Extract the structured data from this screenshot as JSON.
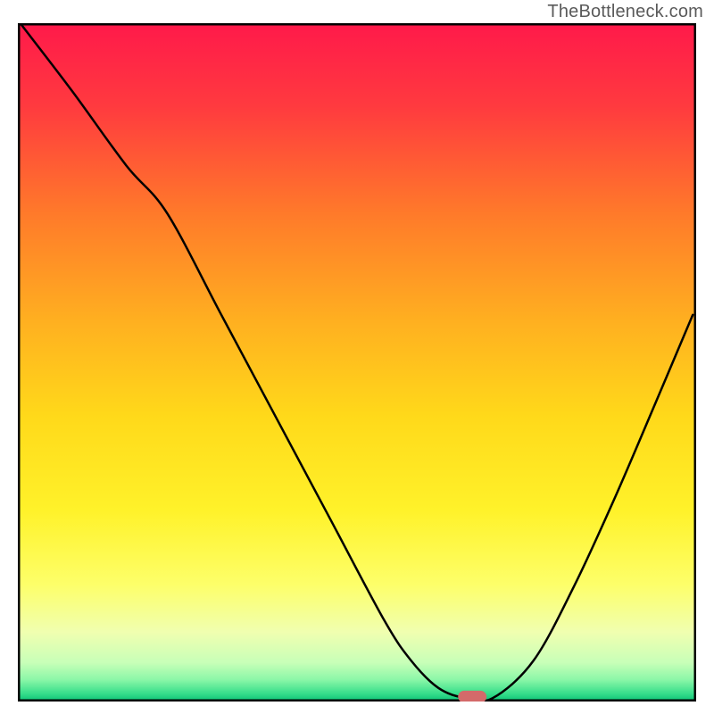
{
  "attribution": "TheBottleneck.com",
  "chart_data": {
    "type": "line",
    "title": "",
    "xlabel": "",
    "ylabel": "",
    "xlim": [
      0,
      100
    ],
    "ylim": [
      0,
      100
    ],
    "background_gradient_stops": [
      {
        "offset": 0.0,
        "color": "#ff1a4a"
      },
      {
        "offset": 0.12,
        "color": "#ff3a3f"
      },
      {
        "offset": 0.28,
        "color": "#ff7a2a"
      },
      {
        "offset": 0.44,
        "color": "#ffb020"
      },
      {
        "offset": 0.58,
        "color": "#ffd91a"
      },
      {
        "offset": 0.72,
        "color": "#fff22a"
      },
      {
        "offset": 0.83,
        "color": "#fdff6a"
      },
      {
        "offset": 0.9,
        "color": "#f0ffb0"
      },
      {
        "offset": 0.945,
        "color": "#c8ffb8"
      },
      {
        "offset": 0.97,
        "color": "#8cf7a8"
      },
      {
        "offset": 0.99,
        "color": "#3adf8c"
      },
      {
        "offset": 1.0,
        "color": "#14c97a"
      }
    ],
    "series": [
      {
        "name": "bottleneck-curve",
        "x": [
          0.5,
          8,
          16,
          22,
          30,
          38,
          46,
          54,
          58,
          62,
          66,
          70,
          76,
          82,
          88,
          94,
          99.5
        ],
        "y": [
          99.8,
          90,
          79,
          72,
          57,
          42,
          27,
          12,
          6,
          2,
          0.5,
          0.5,
          6,
          17,
          30,
          44,
          57
        ]
      }
    ],
    "marker": {
      "name": "optimal-point",
      "x": 67,
      "y": 0.7,
      "color": "#d46a6a",
      "width": 4.2,
      "height": 1.8
    }
  }
}
